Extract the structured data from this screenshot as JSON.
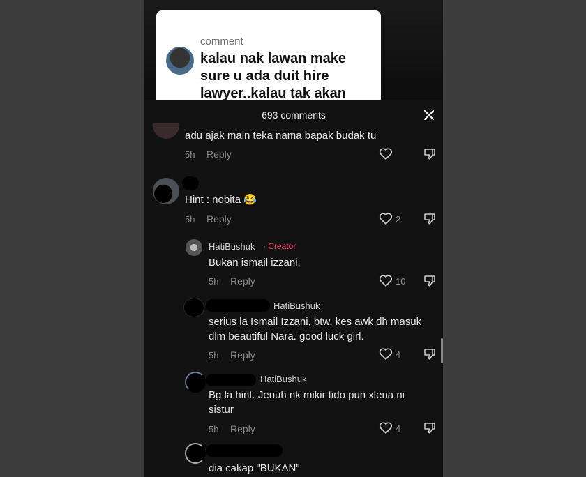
{
  "card": {
    "title": "comment",
    "text": "kalau nak lawan make sure u ada duit hire lawyer..kalau tak akan"
  },
  "sheet": {
    "title": "693 comments"
  },
  "comments": [
    {
      "text": "adu ajak main teka nama bapak budak tu",
      "time": "5h",
      "reply": "Reply",
      "likes": ""
    },
    {
      "text": "Hint : nobita 😂",
      "time": "5h",
      "reply": "Reply",
      "likes": "2"
    },
    {
      "user": "HatiBushuk",
      "badge": "· Creator",
      "text": "Bukan ismail izzani.",
      "time": "5h",
      "reply": "Reply",
      "likes": "10"
    },
    {
      "user": "HatiBushuk",
      "text": "serius la Ismail Izzani, btw, kes awk dh masuk dlm beautiful Nara. good luck girl.",
      "time": "5h",
      "reply": "Reply",
      "likes": "4"
    },
    {
      "user": "HatiBushuk",
      "text": "Bg la hint. Jenuh nk mikir tido pun xlena ni sistur",
      "time": "5h",
      "reply": "Reply",
      "likes": "4"
    },
    {
      "text": "dia cakap \"BUKAN\""
    }
  ],
  "colors": {
    "background": "#3c3c3c",
    "sheet": "#121212",
    "creator_badge": "#ff4d6d"
  },
  "icons": [
    "close-icon",
    "heart-icon",
    "dislike-icon"
  ]
}
